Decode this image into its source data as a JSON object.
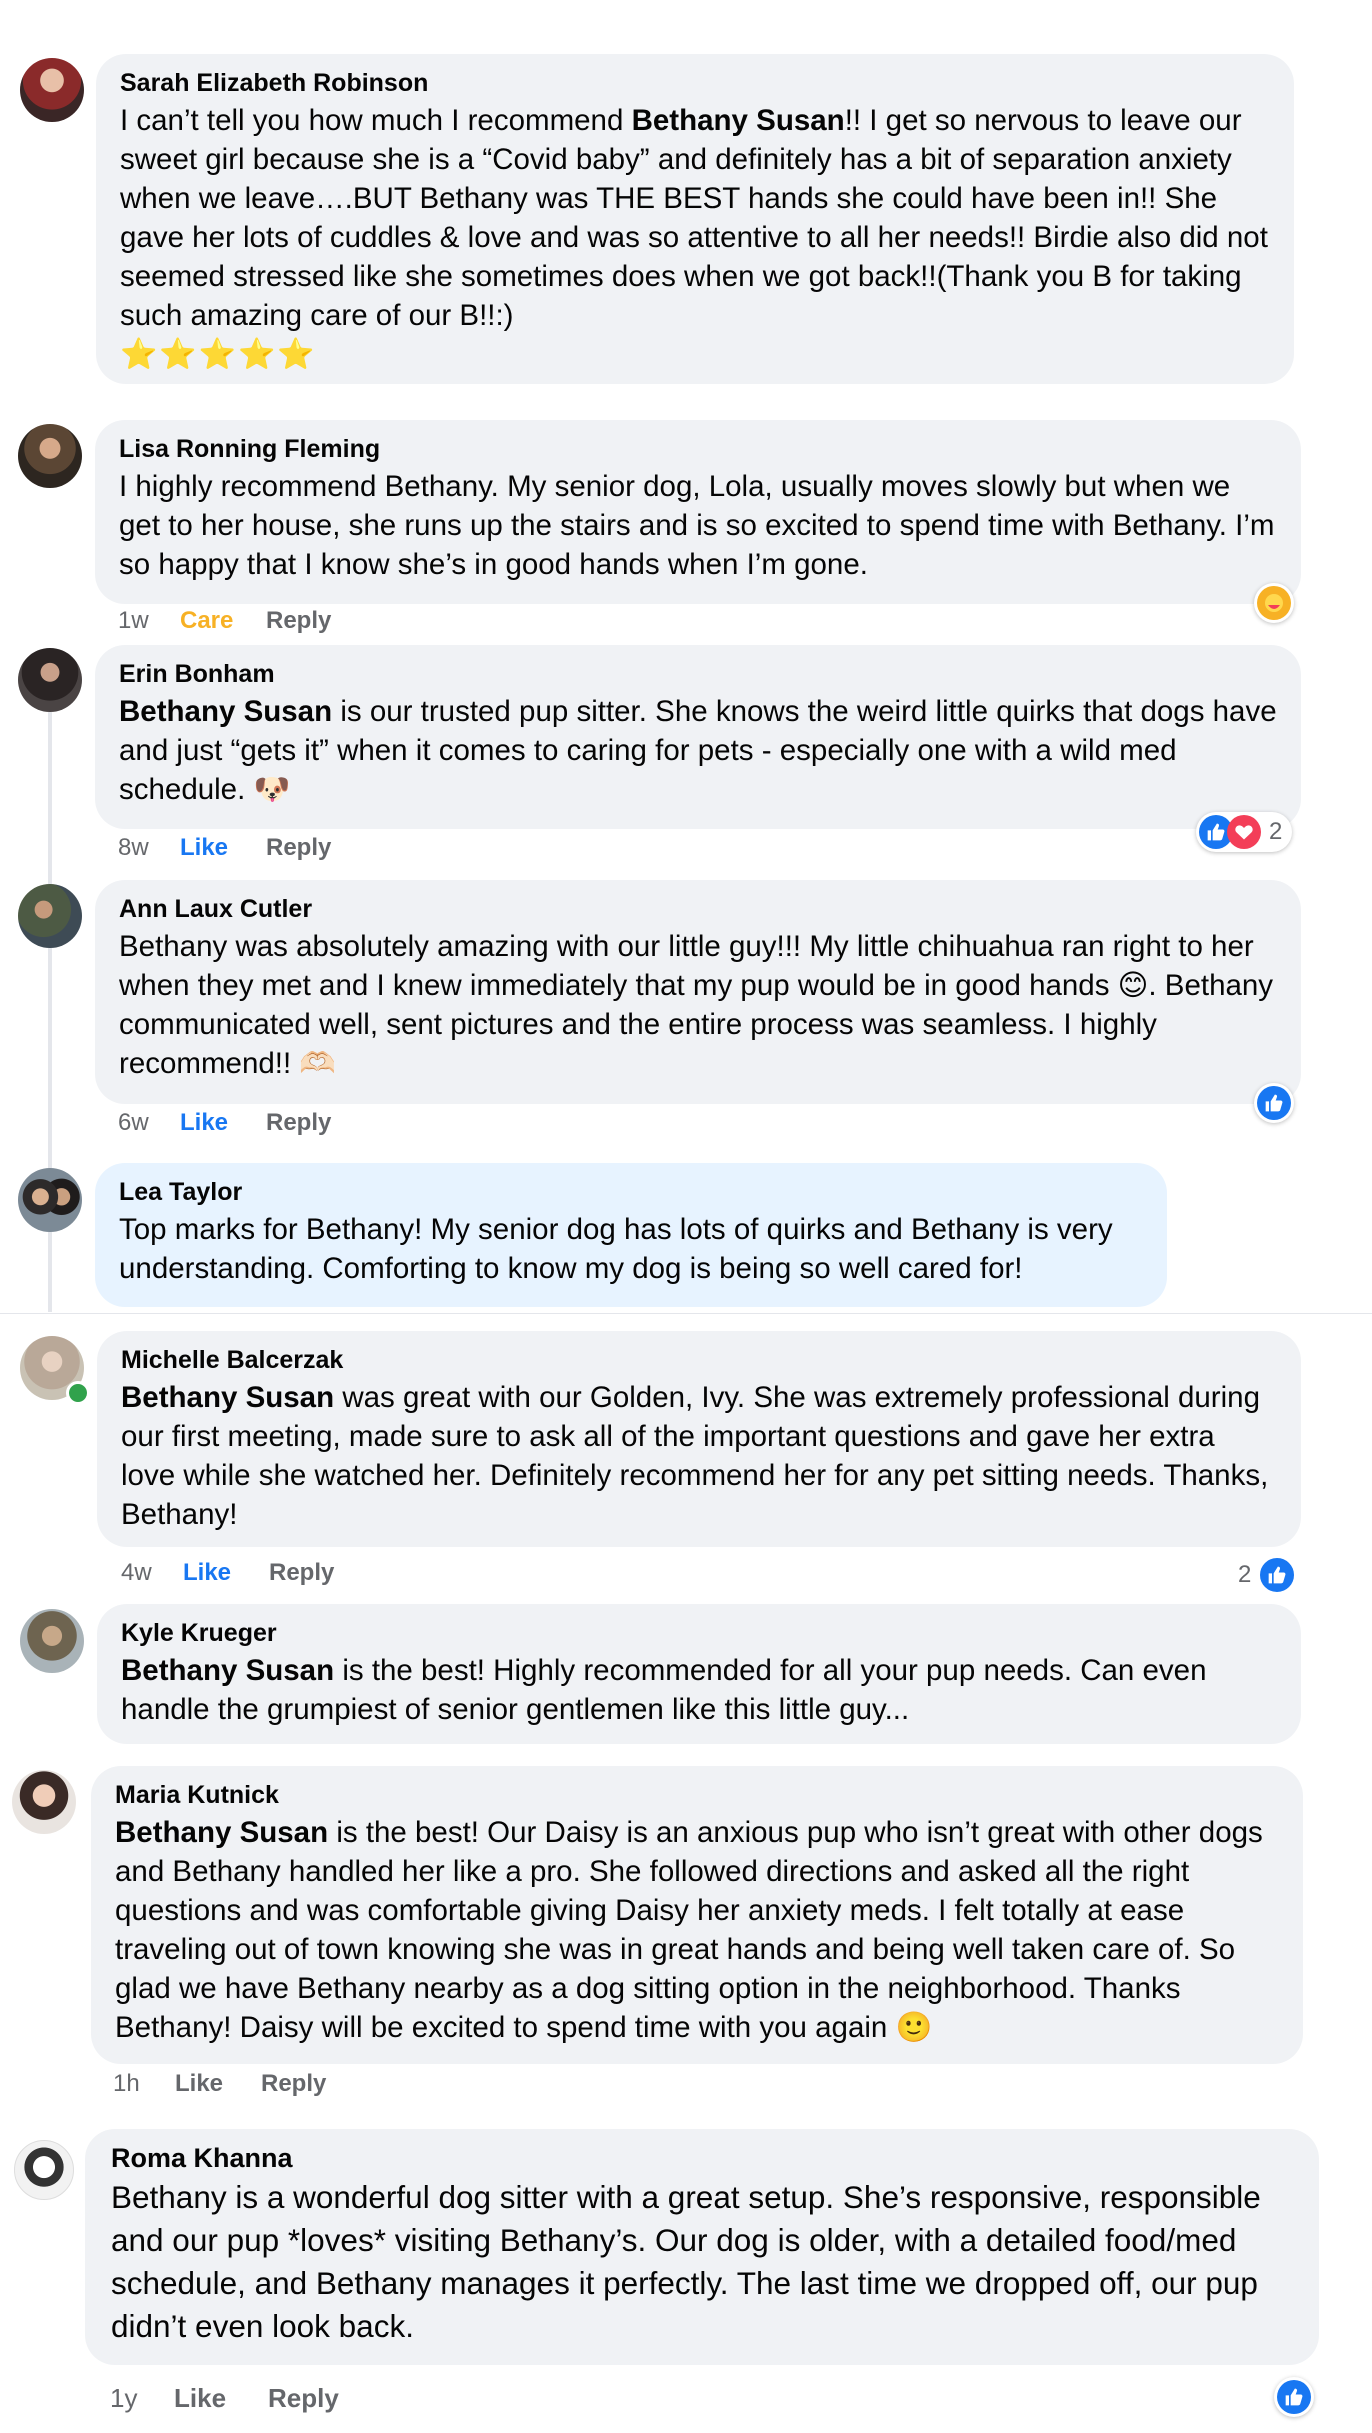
{
  "comments": [
    {
      "name": "Sarah Elizabeth Robinson",
      "text_pre": "I can’t tell you how much I recommend ",
      "mention": "Bethany Susan",
      "text_post": "!! I get so nervous to leave our sweet girl because she is a “Covid baby” and definitely has a bit of separation anxiety when we leave….BUT Bethany was THE BEST hands she could have been in!! She gave her lots of cuddles & love and was so attentive to all her needs!! Birdie also did not seemed stressed like she sometimes does when we got back!!(Thank you B for taking such amazing care of our B!!:)",
      "stars": "⭐⭐⭐⭐⭐"
    },
    {
      "name": "Lisa Ronning Fleming",
      "text": "I highly recommend Bethany. My senior dog, Lola, usually moves slowly but when we get to her house, she runs up the stairs and is so excited to spend time with Bethany. I’m so happy that I know she’s in good hands when I’m gone.",
      "time": "1w",
      "like": "Care",
      "reply": "Reply"
    },
    {
      "name": "Erin Bonham",
      "mention": "Bethany Susan",
      "text_post": " is our trusted pup sitter. She knows the weird little quirks that dogs have and just “gets it” when it comes to caring for pets - especially one with a wild med schedule. 🐶",
      "time": "8w",
      "like": "Like",
      "reply": "Reply",
      "reaction_count": "2"
    },
    {
      "name": "Ann Laux Cutler",
      "text": "Bethany was absolutely amazing with our little guy!!! My little chihuahua ran right to her when they met and I knew immediately that my pup would be in good hands 😊. Bethany communicated well, sent pictures and the entire process was seamless. I highly recommend!! 🫶🏻",
      "time": "6w",
      "like": "Like",
      "reply": "Reply"
    },
    {
      "name": "Lea Taylor",
      "text": "Top marks for Bethany! My senior dog has lots of quirks and Bethany is very understanding. Comforting to know my dog is being so well cared for!"
    },
    {
      "name": "Michelle Balcerzak",
      "mention": "Bethany Susan",
      "text_post": " was great with our Golden, Ivy. She was extremely professional during our first meeting, made sure to ask all of the important questions and gave her extra love while she watched her. Definitely recommend her for any pet sitting needs. Thanks, Bethany!",
      "time": "4w",
      "like": "Like",
      "reply": "Reply",
      "reaction_count": "2"
    },
    {
      "name": "Kyle Krueger",
      "mention": "Bethany Susan",
      "text_post": " is the best! Highly recommended for all your pup needs. Can even handle the grumpiest of senior gentlemen like this little guy..."
    },
    {
      "name": "Maria Kutnick",
      "mention": "Bethany Susan",
      "text_post": " is the best! Our Daisy is an anxious pup who isn’t great with other dogs and Bethany handled her like a pro. She followed directions and asked all the right questions and was comfortable giving Daisy her anxiety meds. I felt totally at ease traveling out of town knowing she was in great hands and being well taken care of. So glad we have Bethany nearby as a dog sitting option in the neighborhood. Thanks Bethany! Daisy will be excited to spend time with you again 🙂",
      "time": "1h",
      "like": "Like",
      "reply": "Reply"
    },
    {
      "name": "Roma Khanna",
      "text": "Bethany is a wonderful dog sitter with a great setup. She’s responsive, responsible and our pup *loves* visiting Bethany’s. Our dog is older, with a detailed food/med schedule, and Bethany manages it perfectly. The last time we dropped off, our pup didn’t even look back.",
      "time": "1y",
      "like": "Like",
      "reply": "Reply"
    }
  ],
  "colors": {
    "bubble": "#f0f2f5",
    "bubble_highlight": "#e7f3ff",
    "like_active": "#1877f2",
    "care": "#f7b125",
    "meta": "#65676b"
  }
}
